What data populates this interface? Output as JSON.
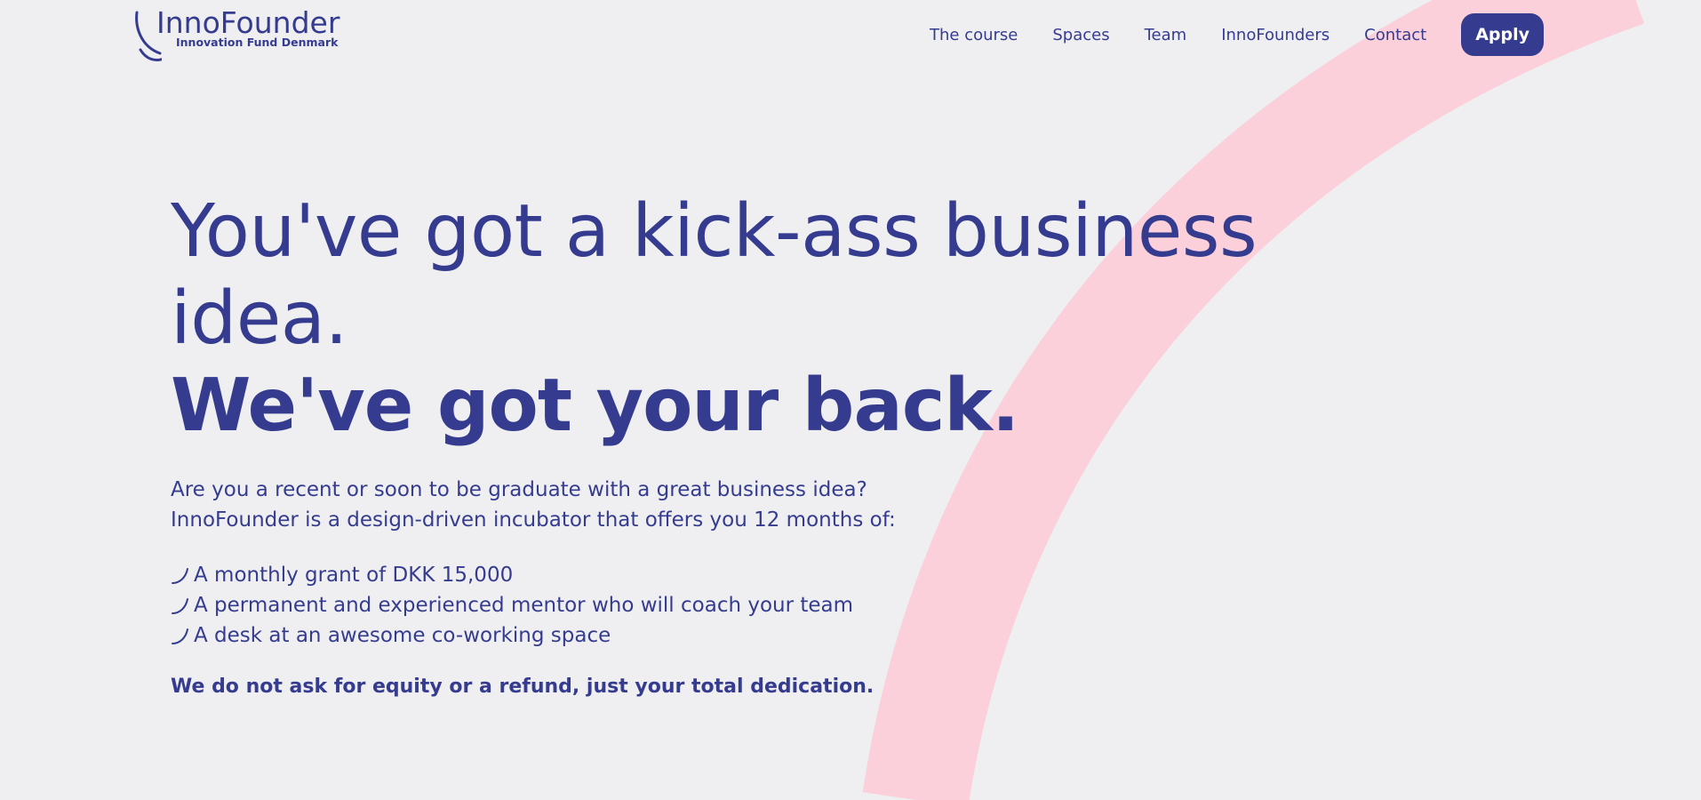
{
  "brand": {
    "name": "InnoFounder",
    "subtitle": "Innovation Fund Denmark",
    "logo_icon": "arc-mark-icon"
  },
  "nav": {
    "items": [
      {
        "label": "The course"
      },
      {
        "label": "Spaces"
      },
      {
        "label": "Team"
      },
      {
        "label": "InnoFounders"
      },
      {
        "label": "Contact"
      }
    ],
    "apply_label": "Apply"
  },
  "hero": {
    "headline_line1": "You've got a kick-ass business",
    "headline_line2": "idea.",
    "headline_bold": "We've got your back.",
    "intro_line1": "Are you a recent or soon to be graduate with a great business idea?",
    "intro_line2": "InnoFounder is a design-driven incubator that offers you 12 months of:",
    "benefits": [
      {
        "text": "A monthly grant of DKK 15,000",
        "icon": "arc-bullet-icon"
      },
      {
        "text": "A permanent and experienced mentor who will coach your team",
        "icon": "arc-bullet-icon"
      },
      {
        "text": "A desk at an awesome co-working space",
        "icon": "arc-bullet-icon"
      }
    ],
    "tagline": "We do not ask for equity or a refund, just your total dedication."
  },
  "colors": {
    "brand_navy": "#353c8f",
    "background": "#efeff2",
    "arc_pink": "#fbd0da",
    "button_text": "#ffffff"
  }
}
